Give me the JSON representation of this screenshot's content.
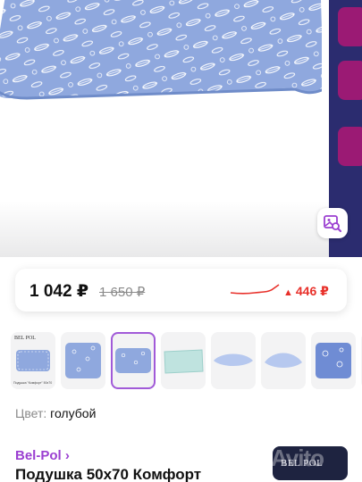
{
  "price": {
    "current": "1 042 ₽",
    "old": "1 650 ₽",
    "drop": "446 ₽",
    "drop_arrow": "▲",
    "colors": {
      "drop": "#e8302a",
      "trend": "#e8302a"
    }
  },
  "gallery": {
    "selected_index": 2,
    "thumbnails": [
      {
        "icon": "pillow-with-label-photo",
        "logo": "BEL POL",
        "caption": "Подушка \"Комфорт\" 50х70"
      },
      {
        "icon": "pillow-feather-print-photo"
      },
      {
        "icon": "pillow-feather-print-photo"
      },
      {
        "icon": "pillow-mint-photo"
      },
      {
        "icon": "pillow-light-blue-photo"
      },
      {
        "icon": "pillow-light-blue-photo"
      },
      {
        "icon": "pillow-dark-feather-photo"
      },
      {
        "icon": "pillow-photo"
      }
    ]
  },
  "color": {
    "label": "Цвет:",
    "value": "голубой"
  },
  "seller": {
    "brand": "Bel-Pol ›",
    "badge_text": "BEL POL",
    "watermark": "Avito"
  },
  "product": {
    "title": "Подушка 50х70 Комфорт"
  },
  "accent": {
    "purple": "#9b3fd1",
    "side_banner": "#2b2c6f",
    "side_card": "#9b1a74"
  },
  "icons": {
    "image_search": "image-search-icon"
  }
}
